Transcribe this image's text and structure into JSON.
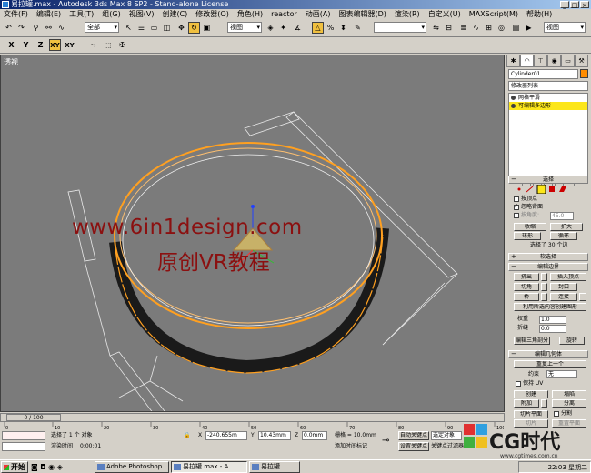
{
  "window": {
    "title": "易拉罐.max - Autodesk 3ds Max 8 SP2  - Stand-alone License"
  },
  "menu": [
    "文件(F)",
    "编辑(E)",
    "工具(T)",
    "组(G)",
    "视图(V)",
    "创建(C)",
    "修改器(O)",
    "角色(H)",
    "reactor",
    "动画(A)",
    "图表编辑器(D)",
    "渲染(R)",
    "自定义(U)",
    "MAXScript(M)",
    "帮助(H)"
  ],
  "toolbar": {
    "selection_filter": "全部",
    "ref_coord": "视图",
    "named_sel": "视图"
  },
  "axis_buttons": [
    "X",
    "Y",
    "Z",
    "XY",
    "XY"
  ],
  "viewport": {
    "label": "透视",
    "watermark_url": "www.6in1design.com",
    "watermark_cn": "原创VR教程"
  },
  "panel": {
    "object_name": "Cylinder01",
    "modifier_list": "修改器列表",
    "stack": [
      "网格平滑",
      "可编辑多边形"
    ],
    "selection": {
      "title": "选择",
      "by_vertex": "按顶点",
      "ignore_backface": "忽略背面",
      "by_angle": "按角度:",
      "angle_value": "45.0",
      "shrink": "收缩",
      "grow": "扩大",
      "ring": "环形",
      "loop": "循环",
      "selected_count": "选择了 30 个边"
    },
    "soft_selection": "软选择",
    "edit_edges": {
      "title": "编辑边界",
      "extrude": "挤出",
      "insert_vertex": "插入顶点",
      "chamfer": "切角",
      "cap": "封口",
      "bridge": "桥",
      "connect": "连接",
      "create_shape": "利用所选内容创建图形",
      "weight_label": "权重",
      "weight_value": "1.0",
      "crease_label": "折缝",
      "crease_value": "0.0",
      "edit_tri": "编辑三角剖分",
      "rotate": "旋转"
    },
    "edit_geometry": {
      "title": "编辑几何体",
      "repeat_last": "重复上一个",
      "constraint_label": "约束",
      "constraint_value": "无",
      "preserve_uv": "保持 UV",
      "create": "创建",
      "collapse": "塌陷",
      "attach": "附加",
      "detach": "分离",
      "slice_plane": "切片平面",
      "split": "分割",
      "slice": "切片",
      "reset_plane": "重置平面"
    }
  },
  "timeline": {
    "frame": "0 / 100",
    "ticks": [
      "0",
      "10",
      "20",
      "30",
      "40",
      "50",
      "60",
      "70",
      "80",
      "90",
      "100"
    ]
  },
  "status": {
    "selected": "选择了 1 个 对象",
    "render_time_label": "渲染时间",
    "render_time": "0:00:01",
    "x_label": "X",
    "x_value": "-240.655m",
    "y_label": "Y",
    "y_value": "10.43mm",
    "z_label": "Z",
    "z_value": "0.0mm",
    "grid": "栅格 = 10.0mm",
    "add_time_tag": "添加时间标记",
    "auto_key": "自动关键点",
    "set_key": "设置关键点",
    "selected_obj": "选定对象",
    "key_filters": "关键点过滤器..."
  },
  "taskbar": {
    "start": "开始",
    "tasks": [
      "Adobe Photoshop",
      "易拉罐.max - A...",
      "易拉罐"
    ],
    "time": "22:03 星期二"
  },
  "logo": {
    "text": "CG时代",
    "url": "www.cgtimes.com.cn"
  }
}
